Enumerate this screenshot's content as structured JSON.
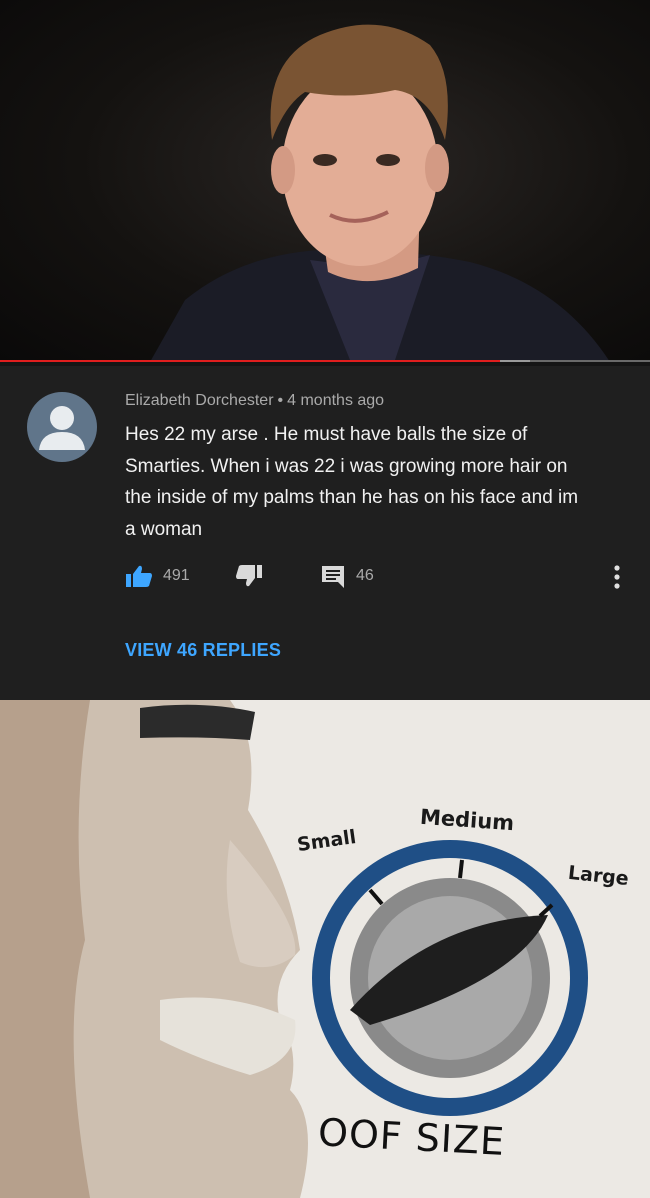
{
  "video": {
    "progress_fraction": 0.77
  },
  "comment": {
    "author": "Elizabeth Dorchester",
    "separator": "•",
    "time": "4 months ago",
    "text_lines": [
      "Hes 22 my arse . He must have balls the size of",
      "Smarties.  When i was 22 i was growing more hair on",
      "the inside of my palms than he has on his face and im",
      "a woman"
    ],
    "likes": "491",
    "replies_count": "46",
    "view_replies": "VIEW 46 REPLIES"
  },
  "meme": {
    "knob_labels": {
      "small": "Small",
      "medium": "Medium",
      "large": "Large"
    },
    "caption": "OOF SIZE"
  },
  "colors": {
    "progress_red": "#e01e1e",
    "link_blue": "#3ea6ff",
    "avatar_bg": "#60758a",
    "panel_bg": "#1f1f1f"
  },
  "icons": {
    "like": "thumb-up-icon",
    "dislike": "thumb-down-icon",
    "reply": "comment-icon",
    "menu": "more-vert-icon"
  }
}
